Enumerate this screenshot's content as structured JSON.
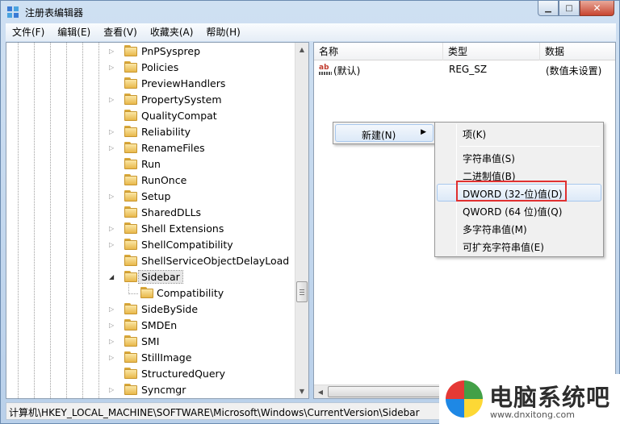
{
  "window": {
    "title": "注册表编辑器",
    "minimize_icon": "minimize-icon",
    "maximize_icon": "maximize-icon",
    "close_icon": "close-icon"
  },
  "menubar": {
    "items": [
      "文件(F)",
      "编辑(E)",
      "查看(V)",
      "收藏夹(A)",
      "帮助(H)"
    ]
  },
  "tree": {
    "items": [
      {
        "label": "PnPSysprep",
        "expandable": true
      },
      {
        "label": "Policies",
        "expandable": true
      },
      {
        "label": "PreviewHandlers",
        "expandable": false
      },
      {
        "label": "PropertySystem",
        "expandable": true
      },
      {
        "label": "QualityCompat",
        "expandable": false
      },
      {
        "label": "Reliability",
        "expandable": true
      },
      {
        "label": "RenameFiles",
        "expandable": true
      },
      {
        "label": "Run",
        "expandable": false
      },
      {
        "label": "RunOnce",
        "expandable": false
      },
      {
        "label": "Setup",
        "expandable": true
      },
      {
        "label": "SharedDLLs",
        "expandable": false
      },
      {
        "label": "Shell Extensions",
        "expandable": true
      },
      {
        "label": "ShellCompatibility",
        "expandable": true
      },
      {
        "label": "ShellServiceObjectDelayLoad",
        "expandable": false
      },
      {
        "label": "Sidebar",
        "expandable": true,
        "expanded": true,
        "selected": true
      },
      {
        "label": "Compatibility",
        "expandable": false,
        "child": true
      },
      {
        "label": "SideBySide",
        "expandable": true
      },
      {
        "label": "SMDEn",
        "expandable": true
      },
      {
        "label": "SMI",
        "expandable": true
      },
      {
        "label": "StillImage",
        "expandable": true
      },
      {
        "label": "StructuredQuery",
        "expandable": false
      },
      {
        "label": "Syncmgr",
        "expandable": true
      }
    ]
  },
  "list": {
    "columns": [
      "名称",
      "类型",
      "数据"
    ],
    "rows": [
      {
        "name": "(默认)",
        "type": "REG_SZ",
        "data": "(数值未设置)",
        "icon": "string-value-icon"
      }
    ]
  },
  "context_menu": {
    "new_label": "新建(N)",
    "submenu": [
      {
        "label": "项(K)"
      },
      {
        "label": "字符串值(S)"
      },
      {
        "label": "二进制值(B)"
      },
      {
        "label": "DWORD (32-位)值(D)",
        "highlighted": true
      },
      {
        "label": "QWORD (64 位)值(Q)"
      },
      {
        "label": "多字符串值(M)"
      },
      {
        "label": "可扩充字符串值(E)"
      }
    ]
  },
  "status": {
    "path": "计算机\\HKEY_LOCAL_MACHINE\\SOFTWARE\\Microsoft\\Windows\\CurrentVersion\\Sidebar"
  },
  "watermark": {
    "title": "电脑系统吧",
    "url": "www.dnxitong.com"
  },
  "colors": {
    "highlight_box": "#e03030",
    "menu_hover": "#dce9f8",
    "folder": "#e8b84b"
  }
}
